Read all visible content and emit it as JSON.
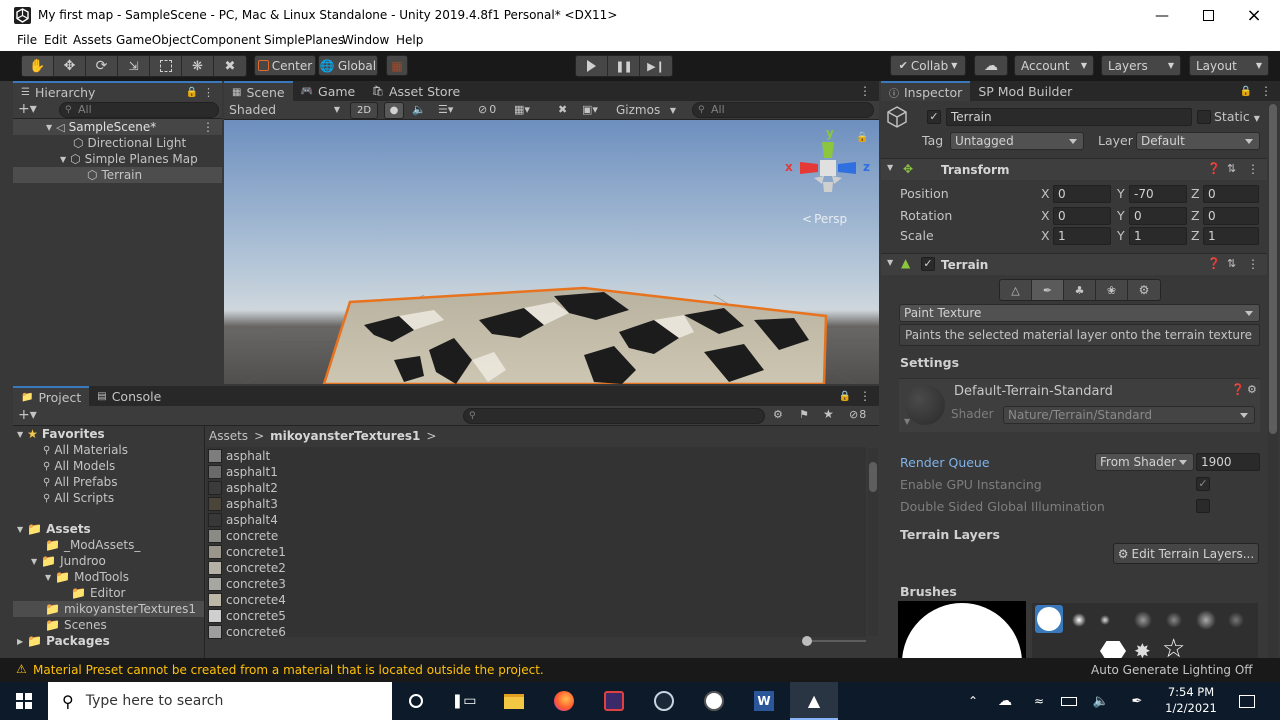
{
  "window": {
    "title": "My first map - SampleScene - PC, Mac & Linux Standalone - Unity 2019.4.8f1 Personal* <DX11>"
  },
  "menu": [
    "File",
    "Edit",
    "Assets",
    "GameObject",
    "Component",
    "SimplePlanes",
    "Window",
    "Help"
  ],
  "toolbar": {
    "pivot_label": "Center",
    "space_label": "Global",
    "collab_label": "Collab",
    "account_label": "Account",
    "layers_label": "Layers",
    "layout_label": "Layout"
  },
  "hierarchy": {
    "tab": "Hierarchy",
    "search_placeholder": "All",
    "scene": "SampleScene*",
    "items": [
      {
        "label": "Directional Light"
      },
      {
        "label": "Simple Planes Map"
      },
      {
        "label": "Terrain"
      }
    ]
  },
  "scene_view": {
    "tabs": [
      "Scene",
      "Game",
      "Asset Store"
    ],
    "shading": "Shaded",
    "mode_2d": "2D",
    "hidden_count": "0",
    "gizmos": "Gizmos",
    "search_placeholder": "All",
    "persp": "Persp",
    "axis_x": "x",
    "axis_y": "y",
    "axis_z": "z"
  },
  "project": {
    "tabs": [
      "Project",
      "Console"
    ],
    "hidden_count": "8",
    "favorites": {
      "title": "Favorites",
      "items": [
        "All Materials",
        "All Models",
        "All Prefabs",
        "All Scripts"
      ]
    },
    "assets": {
      "title": "Assets",
      "items": [
        {
          "label": "_ModAssets_"
        },
        {
          "label": "Jundroo"
        },
        {
          "label": "ModTools"
        },
        {
          "label": "Editor"
        },
        {
          "label": "mikoyansterTextures1"
        },
        {
          "label": "Scenes"
        }
      ]
    },
    "packages": "Packages",
    "breadcrumb_root": "Assets",
    "breadcrumb_folder": "mikoyansterTextures1",
    "files": [
      {
        "name": "asphalt",
        "color": "#7d7d7d"
      },
      {
        "name": "asphalt1",
        "color": "#6a6a6a"
      },
      {
        "name": "asphalt2",
        "color": "#3b3b3b"
      },
      {
        "name": "asphalt3",
        "color": "#4a4538"
      },
      {
        "name": "asphalt4",
        "color": "#383838"
      },
      {
        "name": "concrete",
        "color": "#8a8a86"
      },
      {
        "name": "concrete1",
        "color": "#9a968c"
      },
      {
        "name": "concrete2",
        "color": "#b5b1a6"
      },
      {
        "name": "concrete3",
        "color": "#a6a6a2"
      },
      {
        "name": "concrete4",
        "color": "#bdb7a8"
      },
      {
        "name": "concrete5",
        "color": "#cfcfcf"
      },
      {
        "name": "concrete6",
        "color": "#9e9e9e"
      }
    ]
  },
  "inspector": {
    "tabs": [
      "Inspector",
      "SP Mod Builder"
    ],
    "object_name": "Terrain",
    "static_label": "Static",
    "tag_label": "Tag",
    "tag_value": "Untagged",
    "layer_label": "Layer",
    "layer_value": "Default",
    "transform": {
      "title": "Transform",
      "rows": [
        {
          "label": "Position",
          "x": "0",
          "y": "-70",
          "z": "0"
        },
        {
          "label": "Rotation",
          "x": "0",
          "y": "0",
          "z": "0"
        },
        {
          "label": "Scale",
          "x": "1",
          "y": "1",
          "z": "1"
        }
      ],
      "x_letter": "X",
      "y_letter": "Y",
      "z_letter": "Z"
    },
    "terrain": {
      "title": "Terrain",
      "mode": "Paint Texture",
      "description": "Paints the selected material layer onto the terrain texture",
      "settings_heading": "Settings",
      "material_name": "Default-Terrain-Standard",
      "shader_label": "Shader",
      "shader_value": "Nature/Terrain/Standard",
      "render_queue_label": "Render Queue",
      "render_queue_mode": "From Shader",
      "render_queue_value": "1900",
      "gpu_instancing_label": "Enable GPU Instancing",
      "double_sided_label": "Double Sided Global Illumination",
      "terrain_layers_heading": "Terrain Layers",
      "edit_layers_button": "Edit Terrain Layers...",
      "brushes_heading": "Brushes"
    }
  },
  "status": {
    "warning": "Material Preset cannot be created from a material that is located outside the project.",
    "lighting": "Auto Generate Lighting Off"
  },
  "taskbar": {
    "search_placeholder": "Type here to search",
    "time": "7:54 PM",
    "date": "1/2/2021"
  },
  "colors": {
    "selection": "#2c5d87",
    "accent": "#3a79bb",
    "warning": "#ffc107",
    "taskbar": "#0d1a29"
  }
}
